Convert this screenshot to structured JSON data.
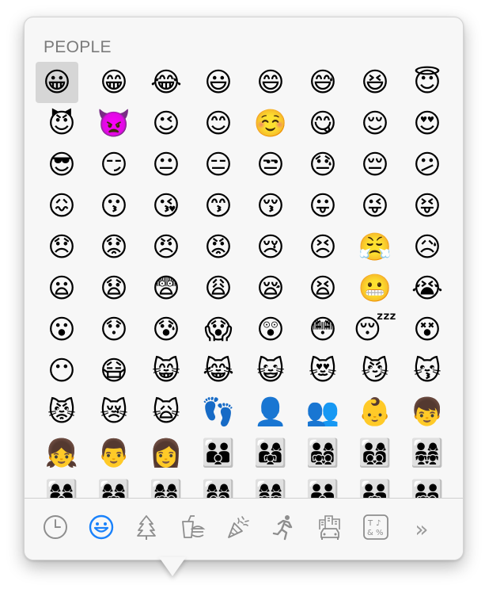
{
  "section": {
    "title": "PEOPLE"
  },
  "emoji_rows": [
    [
      "😀",
      "😁",
      "😂",
      "😃",
      "😄",
      "😅",
      "😆",
      "😇"
    ],
    [
      "😈",
      "👿",
      "😉",
      "😊",
      "☺️",
      "😋",
      "😌",
      "😍"
    ],
    [
      "😎",
      "😏",
      "😐",
      "😑",
      "😒",
      "😓",
      "😔",
      "😕"
    ],
    [
      "😖",
      "😗",
      "😘",
      "😙",
      "😚",
      "😛",
      "😜",
      "😝"
    ],
    [
      "😞",
      "😟",
      "😠",
      "😡",
      "😢",
      "😣",
      "😤",
      "😥"
    ],
    [
      "😦",
      "😧",
      "😨",
      "😩",
      "😪",
      "😫",
      "😬",
      "😭"
    ],
    [
      "😮",
      "😯",
      "😰",
      "😱",
      "😲",
      "😳",
      "😴",
      "😵"
    ],
    [
      "😶",
      "😷",
      "😸",
      "😹",
      "😺",
      "😻",
      "😼",
      "😽"
    ],
    [
      "😾",
      "😿",
      "🙀",
      "👣",
      "👤",
      "👥",
      "👶",
      "👦"
    ],
    [
      "👧",
      "👨",
      "👩",
      "👪",
      "👨‍👩‍👧",
      "👨‍👩‍👧‍👦",
      "👨‍👩‍👦‍👦",
      "👨‍👩‍👧‍👧"
    ],
    [
      "👩‍👩‍👦",
      "👩‍👩‍👧",
      "👩‍👩‍👧‍👦",
      "👩‍👩‍👦‍👦",
      "👩‍👩‍👧‍👧",
      "👨‍👨‍👦",
      "👨‍👨‍👧",
      "👨‍👨‍👧‍👦"
    ]
  ],
  "selected_emoji": "😀",
  "toolbar": {
    "categories": [
      {
        "name": "recent",
        "icon": "clock-icon",
        "active": false
      },
      {
        "name": "people",
        "icon": "smiley-icon",
        "active": true
      },
      {
        "name": "nature",
        "icon": "tree-icon",
        "active": false
      },
      {
        "name": "food-drink",
        "icon": "food-icon",
        "active": false
      },
      {
        "name": "celebration",
        "icon": "party-popper-icon",
        "active": false
      },
      {
        "name": "activity",
        "icon": "runner-icon",
        "active": false
      },
      {
        "name": "travel-places",
        "icon": "buildings-car-icon",
        "active": false
      },
      {
        "name": "symbols",
        "icon": "symbols-icon",
        "active": false
      }
    ],
    "more_label": "»"
  },
  "colors": {
    "accent": "#1a82fb",
    "icon_gray": "#8e8e8e",
    "selection": "#d6d6d6"
  }
}
